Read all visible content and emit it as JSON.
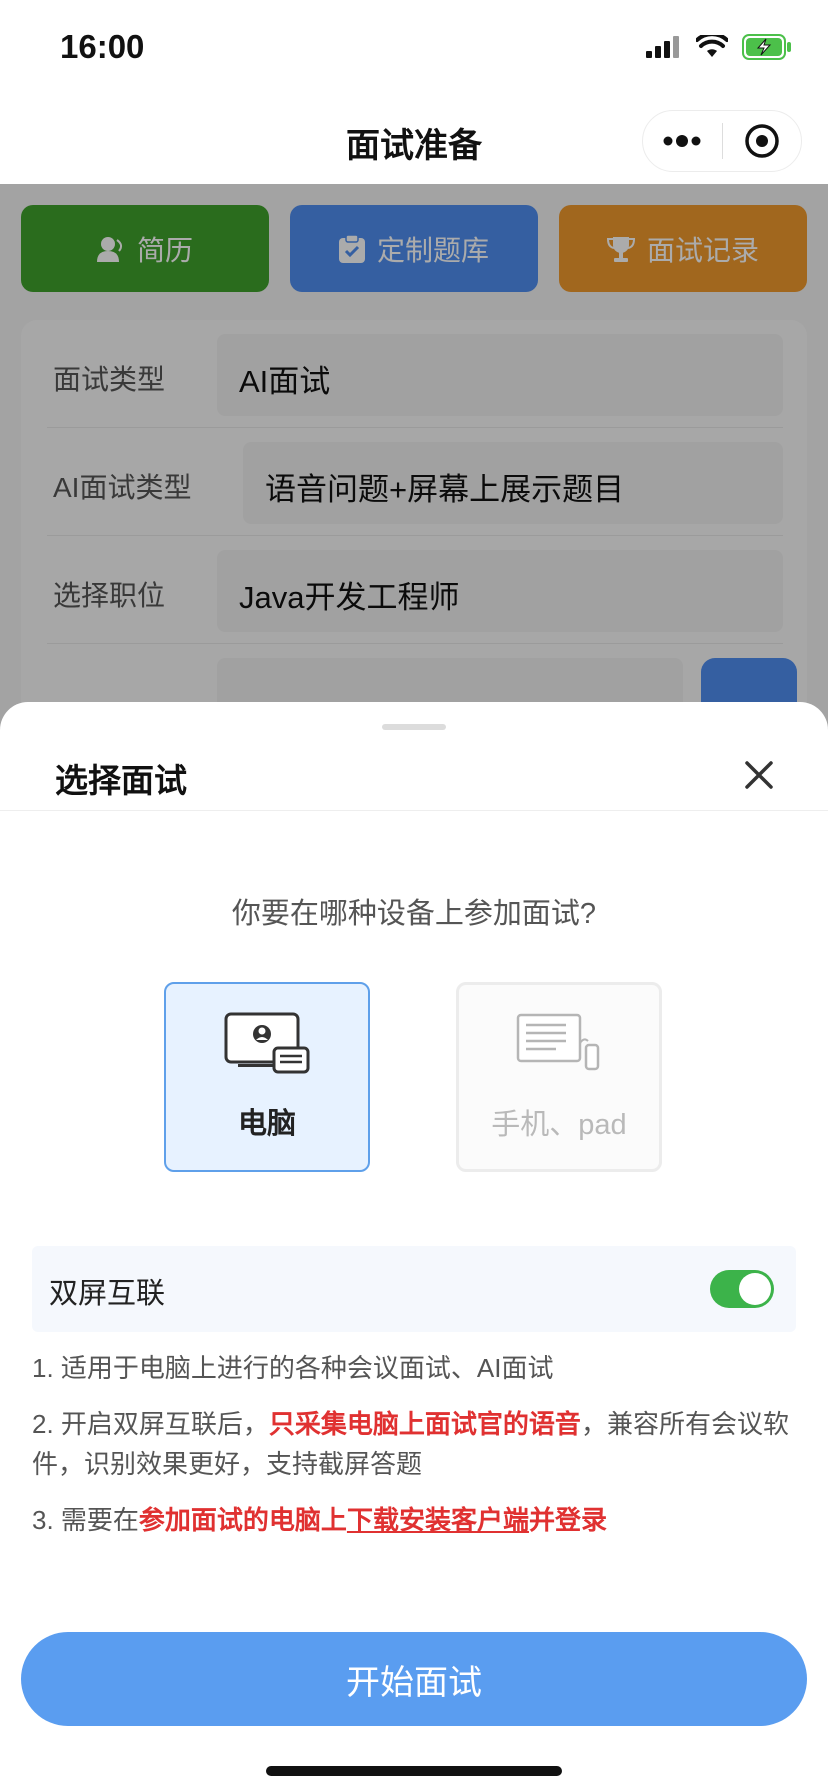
{
  "status_bar": {
    "time": "16:00"
  },
  "nav": {
    "title": "面试准备"
  },
  "top_buttons": [
    {
      "label": "简历",
      "icon": "person-icon",
      "color": "#3fa22c"
    },
    {
      "label": "定制题库",
      "icon": "clipboard-icon",
      "color": "#4f8ef0"
    },
    {
      "label": "面试记录",
      "icon": "trophy-icon",
      "color": "#f09a2d"
    }
  ],
  "form": {
    "rows": [
      {
        "label": "面试类型",
        "value": "AI面试"
      },
      {
        "label": "AI面试类型",
        "value": "语音问题+屏幕上展示题目"
      },
      {
        "label": "选择职位",
        "value": "Java开发工程师"
      }
    ]
  },
  "sheet": {
    "title": "选择面试",
    "question": "你要在哪种设备上参加面试?",
    "devices": [
      {
        "label": "电脑",
        "selected": true,
        "icon": "monitor-icon"
      },
      {
        "label": "手机、pad",
        "selected": false,
        "icon": "tablet-phone-icon"
      }
    ],
    "dual_screen": {
      "label": "双屏互联",
      "enabled": true
    },
    "notes": {
      "n1": "1. 适用于电脑上进行的各种会议面试、AI面试",
      "n2_a": "2. 开启双屏互联后，",
      "n2_b": "只采集电脑上面试官的语音",
      "n2_c": "，兼容所有会议软件，识别效果更好，支持截屏答题",
      "n3_a": "3. 需要在",
      "n3_b": "参加面试的电脑上",
      "n3_c": "下载安装客户端",
      "n3_d": "并登录"
    },
    "start_button": "开始面试"
  },
  "colors": {
    "accent": "#5a9df0",
    "toggle_on": "#3cb34a",
    "warning": "#e03131"
  }
}
